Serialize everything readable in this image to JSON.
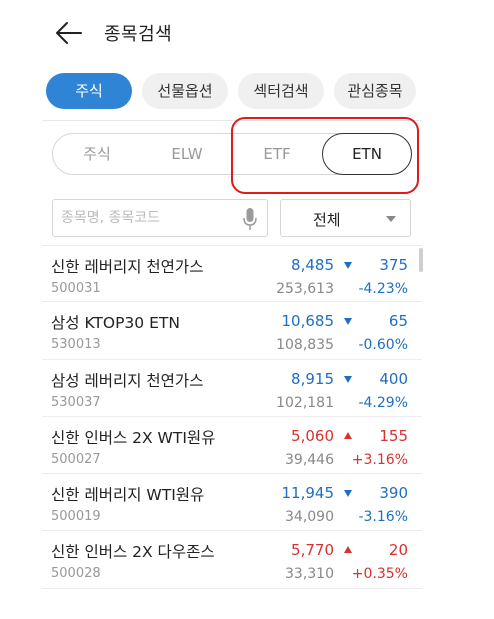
{
  "header": {
    "title": "종목검색"
  },
  "main_tabs": [
    {
      "label": "주식",
      "active": true
    },
    {
      "label": "선물옵션",
      "active": false
    },
    {
      "label": "섹터검색",
      "active": false
    },
    {
      "label": "관심종목",
      "active": false
    }
  ],
  "sub_tabs": [
    {
      "label": "주식",
      "active": false
    },
    {
      "label": "ELW",
      "active": false
    },
    {
      "label": "ETF",
      "active": false
    },
    {
      "label": "ETN",
      "active": true
    }
  ],
  "search": {
    "placeholder": "종목명, 종목코드",
    "value": ""
  },
  "filter": {
    "selected": "전체"
  },
  "colors": {
    "accent": "#2f84d6",
    "down": "#1e6fc2",
    "up": "#d6322f",
    "highlight": "#e01b1b"
  },
  "stocks": [
    {
      "name": "신한 레버리지 천연가스",
      "code": "500031",
      "price": "8,485",
      "direction": "down",
      "change": "375",
      "volume": "253,613",
      "rate": "-4.23%"
    },
    {
      "name": "삼성 KTOP30 ETN",
      "code": "530013",
      "price": "10,685",
      "direction": "down",
      "change": "65",
      "volume": "108,835",
      "rate": "-0.60%"
    },
    {
      "name": "삼성 레버리지 천연가스",
      "code": "530037",
      "price": "8,915",
      "direction": "down",
      "change": "400",
      "volume": "102,181",
      "rate": "-4.29%"
    },
    {
      "name": "신한 인버스 2X WTI원유",
      "code": "500027",
      "price": "5,060",
      "direction": "up",
      "change": "155",
      "volume": "39,446",
      "rate": "+3.16%"
    },
    {
      "name": "신한 레버리지 WTI원유",
      "code": "500019",
      "price": "11,945",
      "direction": "down",
      "change": "390",
      "volume": "34,090",
      "rate": "-3.16%"
    },
    {
      "name": "신한 인버스 2X 다우존스",
      "code": "500028",
      "price": "5,770",
      "direction": "up",
      "change": "20",
      "volume": "33,310",
      "rate": "+0.35%"
    }
  ]
}
